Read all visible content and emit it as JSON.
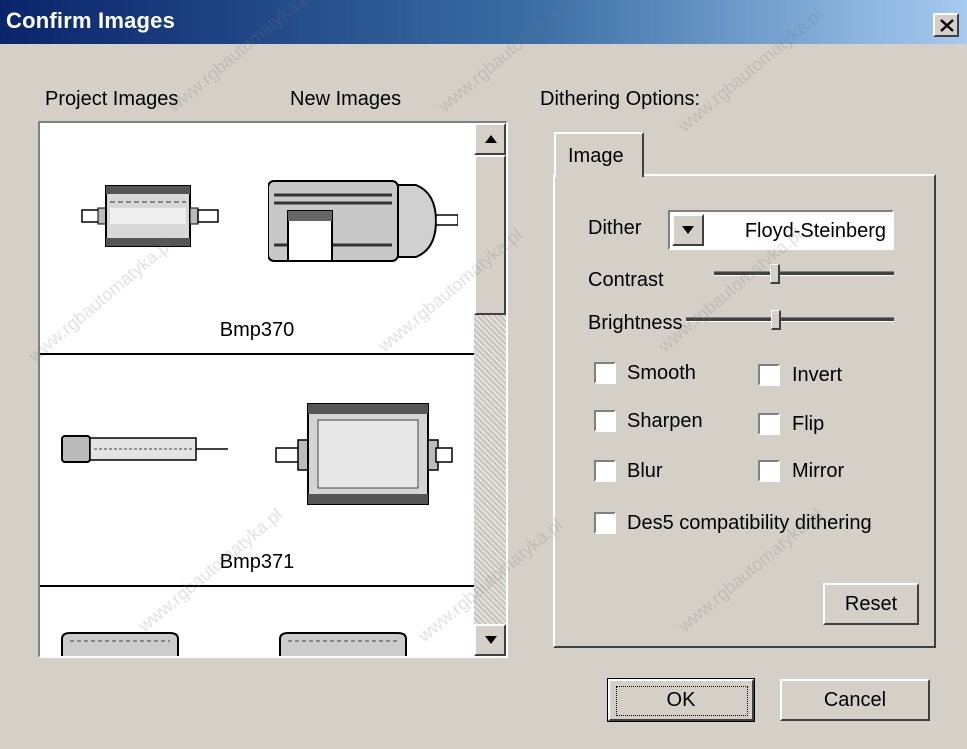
{
  "window": {
    "title": "Confirm Images",
    "close_symbol": "close-icon"
  },
  "columns": {
    "project_images": "Project Images",
    "new_images": "New Images"
  },
  "image_list": {
    "items": [
      {
        "caption": "Bmp370"
      },
      {
        "caption": "Bmp371"
      },
      {
        "caption": ""
      }
    ]
  },
  "dithering": {
    "section_label": "Dithering Options:",
    "tab_label": "Image",
    "dither_label": "Dither",
    "dither_value": "Floyd-Steinberg",
    "contrast_label": "Contrast",
    "contrast_level": 0.33,
    "brightness_label": "Brightness",
    "brightness_level": 0.43,
    "checkboxes": {
      "smooth": {
        "label": "Smooth",
        "checked": false
      },
      "invert": {
        "label": "Invert",
        "checked": false
      },
      "sharpen": {
        "label": "Sharpen",
        "checked": false
      },
      "flip": {
        "label": "Flip",
        "checked": false
      },
      "blur": {
        "label": "Blur",
        "checked": false
      },
      "mirror": {
        "label": "Mirror",
        "checked": false
      },
      "des5": {
        "label": "Des5 compatibility dithering",
        "checked": false
      }
    },
    "reset_label": "Reset"
  },
  "buttons": {
    "ok_label": "OK",
    "cancel_label": "Cancel"
  },
  "watermark": "www.rgbautomatyka.pl",
  "colors": {
    "title_start": "#0a246a",
    "title_end": "#a6caf0",
    "face": "#d4d0c8"
  }
}
